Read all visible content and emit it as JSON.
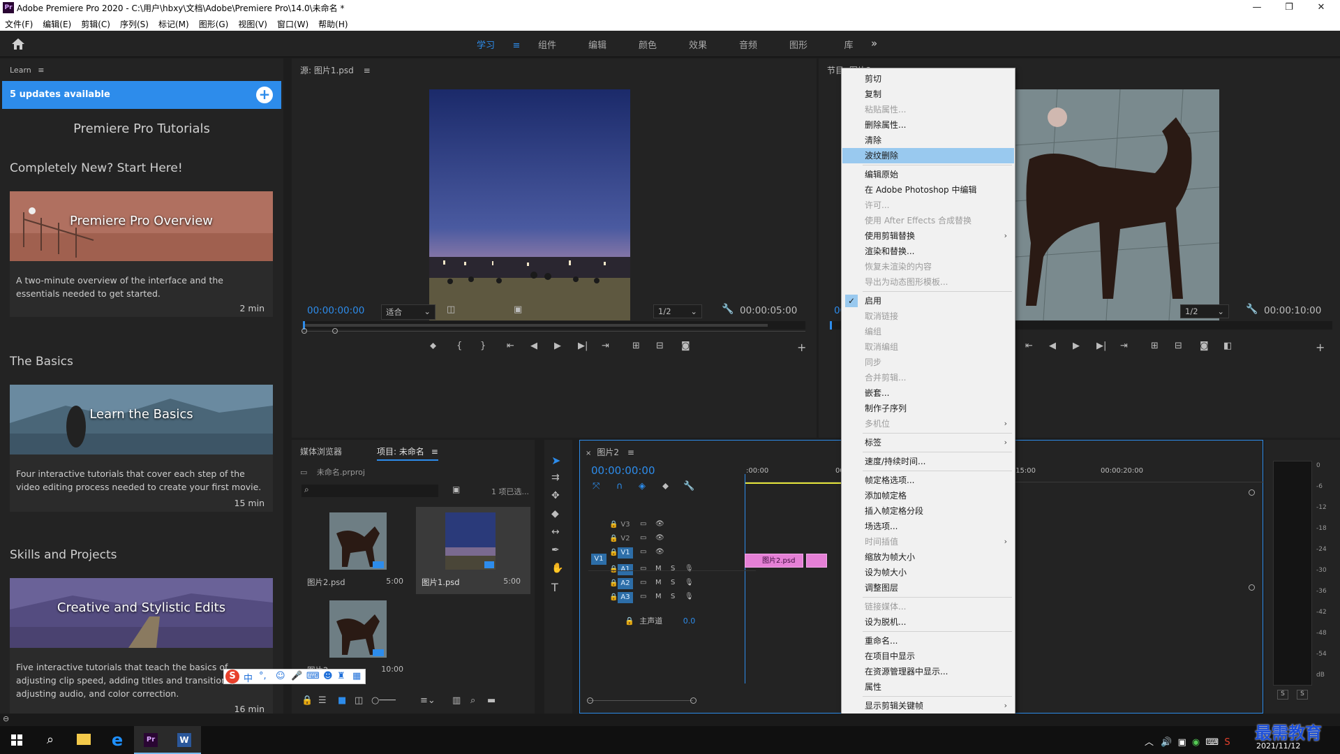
{
  "window": {
    "title": "Adobe Premiere Pro 2020 - C:\\用户\\hbxy\\文档\\Adobe\\Premiere Pro\\14.0\\未命名 *",
    "logo_text": "Pr",
    "menu": [
      "文件(F)",
      "编辑(E)",
      "剪辑(C)",
      "序列(S)",
      "标记(M)",
      "图形(G)",
      "视图(V)",
      "窗口(W)",
      "帮助(H)"
    ]
  },
  "workspaces": {
    "tabs": [
      "学习",
      "组件",
      "编辑",
      "颜色",
      "效果",
      "音频",
      "图形",
      "库"
    ],
    "active": "学习",
    "more": "»"
  },
  "learn": {
    "header": "Learn",
    "updates": "5 updates available",
    "title": "Premiere Pro Tutorials",
    "sections": [
      {
        "heading": "Completely New? Start Here!",
        "card_title": "Premiere Pro Overview",
        "desc": "A two-minute overview of the interface and the essentials needed to get started.",
        "duration": "2 min"
      },
      {
        "heading": "The Basics",
        "card_title": "Learn the Basics",
        "desc": "Four interactive tutorials that cover each step of the video editing process needed to create your first movie.",
        "duration": "15 min"
      },
      {
        "heading": "Skills and Projects",
        "card_title": "Creative and Stylistic Edits",
        "desc": "Five interactive tutorials that teach the basics of adjusting clip speed, adding titles and transitions, adjusting audio, and color correction.",
        "duration": "16 min"
      }
    ]
  },
  "source": {
    "title": "源: 图片1.psd",
    "timecode_in": "00:00:00:00",
    "fit": "适合",
    "resolution": "1/2",
    "timecode_dur": "00:00:05:00"
  },
  "program": {
    "title": "节目: 图片2",
    "timecode_in": "00",
    "resolution": "1/2",
    "timecode_dur": "00:00:10:00"
  },
  "project": {
    "tab_media": "媒体浏览器",
    "tab_project": "项目: 未命名",
    "file": "未命名.prproj",
    "selected_count": "1 项已选...",
    "items": [
      {
        "name": "图片2.psd",
        "dur": "5:00"
      },
      {
        "name": "图片1.psd",
        "dur": "5:00"
      },
      {
        "name": "图片2",
        "dur": "10:00"
      }
    ]
  },
  "timeline": {
    "tab": "图片2",
    "timecode": "00:00:00:00",
    "ruler": [
      ":00:00",
      "00",
      "00:00:15:00",
      "00:00:20:00"
    ],
    "tracks": [
      "V3",
      "V2",
      "V1",
      "A1",
      "A2",
      "A3"
    ],
    "src_track": "V1",
    "master": "主声道",
    "master_val": "0.0",
    "clip_label": "图片2.psd",
    "track_m": "M",
    "track_s": "S"
  },
  "meter": {
    "scale": [
      "0",
      "-6",
      "-12",
      "-18",
      "-24",
      "-30",
      "-36",
      "-42",
      "-48",
      "-54",
      "dB"
    ],
    "solo": [
      "S",
      "S"
    ]
  },
  "context_menu": {
    "items": [
      {
        "label": "剪切"
      },
      {
        "label": "复制"
      },
      {
        "label": "粘贴属性...",
        "disabled": true
      },
      {
        "label": "删除属性..."
      },
      {
        "label": "清除"
      },
      {
        "label": "波纹删除",
        "highlight": true
      },
      {
        "sep": true
      },
      {
        "label": "编辑原始"
      },
      {
        "label": "在 Adobe Photoshop 中编辑"
      },
      {
        "label": "许可...",
        "disabled": true
      },
      {
        "label": "使用 After Effects 合成替换",
        "disabled": true
      },
      {
        "label": "使用剪辑替换",
        "submenu": true
      },
      {
        "label": "渲染和替换..."
      },
      {
        "label": "恢复未渲染的内容",
        "disabled": true
      },
      {
        "label": "导出为动态图形模板...",
        "disabled": true
      },
      {
        "sep": true
      },
      {
        "label": "启用",
        "checked": true
      },
      {
        "label": "取消链接",
        "disabled": true
      },
      {
        "label": "编组",
        "disabled": true
      },
      {
        "label": "取消编组",
        "disabled": true
      },
      {
        "label": "同步",
        "disabled": true
      },
      {
        "label": "合并剪辑...",
        "disabled": true
      },
      {
        "label": "嵌套..."
      },
      {
        "label": "制作子序列"
      },
      {
        "label": "多机位",
        "disabled": true,
        "submenu": true
      },
      {
        "sep": true
      },
      {
        "label": "标签",
        "submenu": true
      },
      {
        "sep": true
      },
      {
        "label": "速度/持续时间..."
      },
      {
        "sep": true
      },
      {
        "label": "帧定格选项..."
      },
      {
        "label": "添加帧定格"
      },
      {
        "label": "插入帧定格分段"
      },
      {
        "label": "场选项..."
      },
      {
        "label": "时间插值",
        "disabled": true,
        "submenu": true
      },
      {
        "label": "缩放为帧大小"
      },
      {
        "label": "设为帧大小"
      },
      {
        "label": "调整图层"
      },
      {
        "sep": true
      },
      {
        "label": "链接媒体...",
        "disabled": true
      },
      {
        "label": "设为脱机..."
      },
      {
        "sep": true
      },
      {
        "label": "重命名..."
      },
      {
        "label": "在项目中显示"
      },
      {
        "label": "在资源管理器中显示..."
      },
      {
        "label": "属性"
      },
      {
        "sep": true
      },
      {
        "label": "显示剪辑关键帧",
        "submenu": true
      }
    ],
    "check_mark": "✓",
    "arrow": "›"
  },
  "ime": {
    "logo": "S",
    "lang": "中"
  },
  "taskbar": {
    "date": "2021/11/12",
    "watermark": "最需教育"
  },
  "colors": {
    "accent": "#2d8ceb",
    "clip_pink": "#e580d6",
    "menu_highlight": "#99c9ef"
  }
}
